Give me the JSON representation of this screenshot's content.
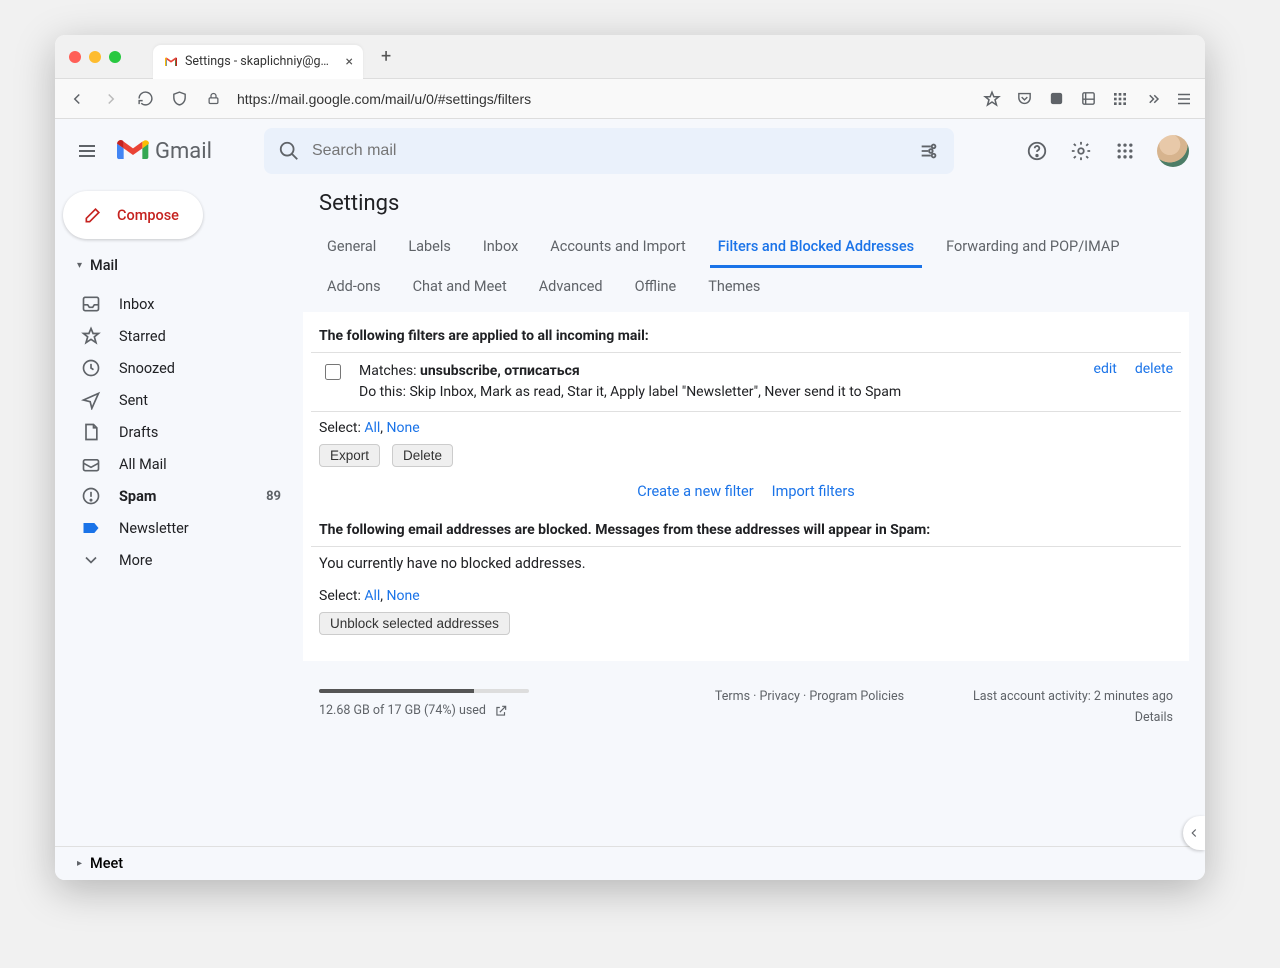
{
  "browser": {
    "tab_title": "Settings - skaplichniy@gmail.co",
    "url": "https://mail.google.com/mail/u/0/#settings/filters"
  },
  "header": {
    "app_name": "Gmail",
    "search_placeholder": "Search mail"
  },
  "compose_label": "Compose",
  "sidebar": {
    "mail_label": "Mail",
    "items": [
      {
        "label": "Inbox"
      },
      {
        "label": "Starred"
      },
      {
        "label": "Snoozed"
      },
      {
        "label": "Sent"
      },
      {
        "label": "Drafts"
      },
      {
        "label": "All Mail"
      },
      {
        "label": "Spam",
        "count": "89",
        "bold": true
      },
      {
        "label": "Newsletter"
      },
      {
        "label": "More"
      }
    ],
    "meet_label": "Meet"
  },
  "page": {
    "title": "Settings",
    "tabs": [
      "General",
      "Labels",
      "Inbox",
      "Accounts and Import",
      "Filters and Blocked Addresses",
      "Forwarding and POP/IMAP",
      "Add-ons",
      "Chat and Meet",
      "Advanced",
      "Offline",
      "Themes"
    ],
    "active_tab": "Filters and Blocked Addresses",
    "filters_heading": "The following filters are applied to all incoming mail:",
    "filter": {
      "matches_label": "Matches: ",
      "matches_value": "unsubscribe, отписаться",
      "do_this_label": "Do this: ",
      "do_this_value": "Skip Inbox, Mark as read, Star it, Apply label \"Newsletter\", Never send it to Spam",
      "edit": "edit",
      "delete": "delete"
    },
    "select_label": "Select: ",
    "select_all": "All",
    "select_none": "None",
    "export_btn": "Export",
    "delete_btn": "Delete",
    "create_filter": "Create a new filter",
    "import_filters": "Import filters",
    "blocked_heading": "The following email addresses are blocked. Messages from these addresses will appear in Spam:",
    "no_blocked": "You currently have no blocked addresses.",
    "unblock_btn": "Unblock selected addresses"
  },
  "footer": {
    "storage_text": "12.68 GB of 17 GB (74%) used",
    "terms": "Terms",
    "privacy": "Privacy",
    "policies": "Program Policies",
    "activity": "Last account activity: 2 minutes ago",
    "details": "Details"
  }
}
